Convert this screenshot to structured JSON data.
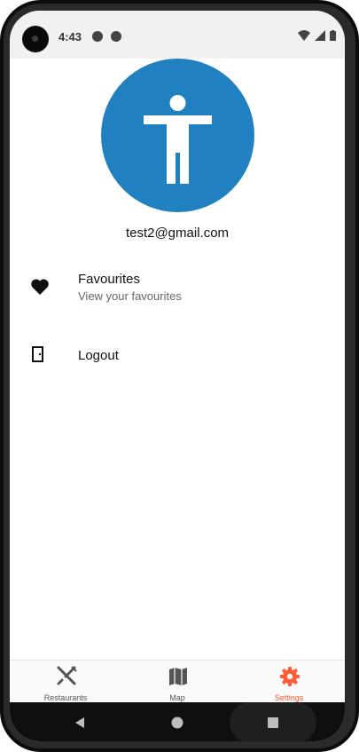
{
  "statusbar": {
    "time": "4:43"
  },
  "profile": {
    "email": "test2@gmail.com",
    "avatar_color": "#2080c0"
  },
  "menu": {
    "favourites_title": "Favourites",
    "favourites_subtitle": "View your favourites",
    "logout_title": "Logout"
  },
  "tabs": [
    {
      "label": "Restaurants",
      "icon": "fork-knife-icon",
      "active": false
    },
    {
      "label": "Map",
      "icon": "map-icon",
      "active": false
    },
    {
      "label": "Settings",
      "icon": "gear-icon",
      "active": true
    }
  ],
  "colors": {
    "accent": "#ff5a36",
    "tab_inactive": "#555555"
  }
}
